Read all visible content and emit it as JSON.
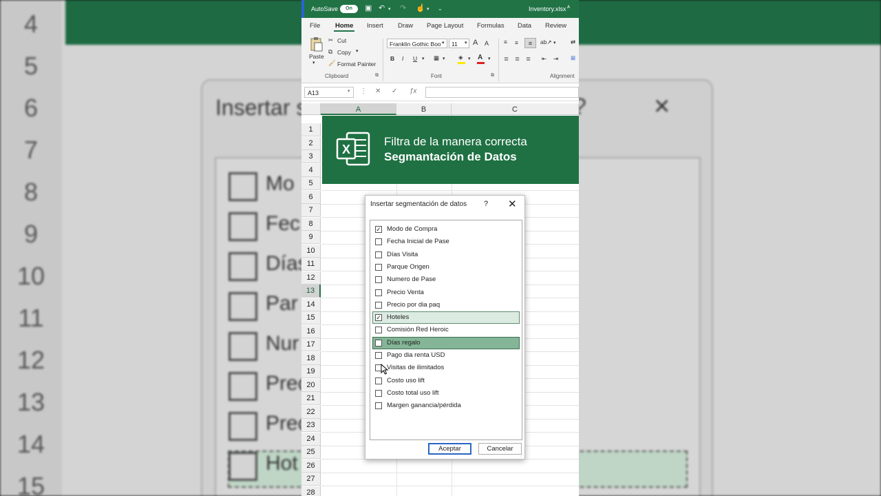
{
  "background": {
    "row_numbers": [
      "4",
      "5",
      "6",
      "7",
      "8",
      "9",
      "10",
      "11",
      "12",
      "13",
      "14",
      "15"
    ],
    "dialog_title_fragment": "Insertar s",
    "help_glyph": "?",
    "close_glyph": "×",
    "item_fragments": [
      "Mo",
      "Fec",
      "Días",
      "Par",
      "Nur",
      "Prec",
      "Prec",
      "Hot"
    ]
  },
  "titlebar": {
    "autosave_label": "AutoSave",
    "autosave_state": "On",
    "filename": "Inventory.xlsx"
  },
  "ribbon": {
    "tabs": [
      "File",
      "Home",
      "Insert",
      "Draw",
      "Page Layout",
      "Formulas",
      "Data",
      "Review"
    ],
    "active_tab": "Home",
    "paste_label": "Paste",
    "cut_label": "Cut",
    "copy_label": "Copy",
    "format_painter_label": "Format Painter",
    "clipboard_group": "Clipboard",
    "font_name": "Franklin Gothic Boo",
    "font_size": "11",
    "font_group": "Font",
    "alignment_group": "Alignment",
    "bold_label": "B",
    "italic_label": "I",
    "underline_label": "U",
    "grow_font_label": "A",
    "shrink_font_label": "A",
    "font_color_label": "A"
  },
  "formula_bar": {
    "name_box": "A13",
    "formula": ""
  },
  "grid": {
    "columns": [
      "A",
      "B",
      "C"
    ],
    "selected_column": "A",
    "rows": [
      "1",
      "2",
      "3",
      "4",
      "5",
      "6",
      "7",
      "8",
      "9",
      "10",
      "11",
      "12",
      "13",
      "14",
      "15",
      "16",
      "17",
      "18",
      "19",
      "20",
      "21",
      "22",
      "23",
      "24",
      "25",
      "26",
      "27",
      "28"
    ],
    "selected_row": "13"
  },
  "banner": {
    "line1": "Filtra de la manera correcta",
    "line2": "Segmantación de Datos",
    "logo_letter": "X",
    "accent": "#1f7143"
  },
  "dialog": {
    "title": "Insertar segmentación de datos",
    "help_label": "?",
    "close_label": "✕",
    "items": [
      {
        "label": "Modo de Compra",
        "checked": true
      },
      {
        "label": "Fecha Inicial de Pase",
        "checked": false
      },
      {
        "label": "Días Visita",
        "checked": false
      },
      {
        "label": "Parque Origen",
        "checked": false
      },
      {
        "label": "Numero de Pase",
        "checked": false
      },
      {
        "label": "Precio Venta",
        "checked": false
      },
      {
        "label": "Precio por dia paq",
        "checked": false
      },
      {
        "label": "Hoteles",
        "checked": true
      },
      {
        "label": "Comisión Red Heroic",
        "checked": false
      },
      {
        "label": "Días regalo",
        "checked": false
      },
      {
        "label": "Pago dia renta USD",
        "checked": false
      },
      {
        "label": "Visitas de ilimitados",
        "checked": false
      },
      {
        "label": "Costo uso lift",
        "checked": false
      },
      {
        "label": "Costo total uso lift",
        "checked": false
      },
      {
        "label": "Margen ganancia/pérdida",
        "checked": false
      }
    ],
    "ok_label": "Aceptar",
    "cancel_label": "Cancelar"
  }
}
